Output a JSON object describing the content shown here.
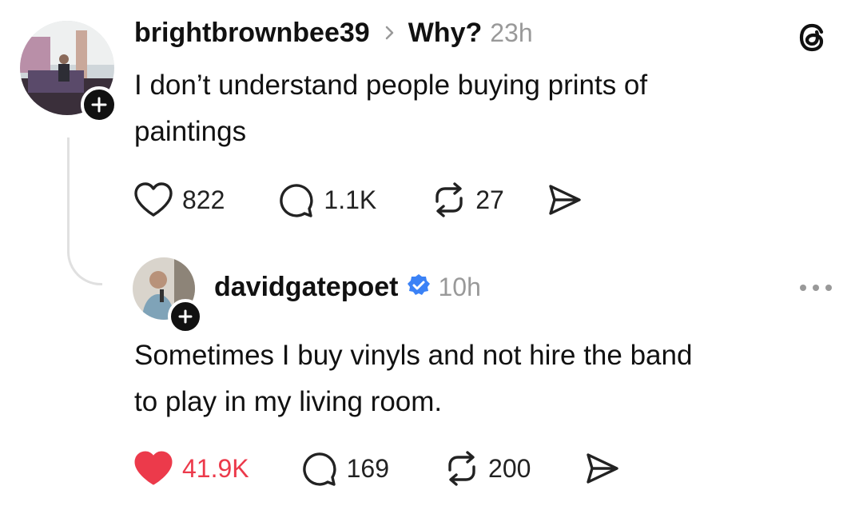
{
  "post": {
    "username": "brightbrownbee39",
    "topic": "Why?",
    "time": "23h",
    "text_line1": "I don’t understand people buying prints of",
    "text_line2": "paintings",
    "likes": "822",
    "replies": "1.1K",
    "reposts": "27"
  },
  "reply": {
    "username": "davidgatepoet",
    "time": "10h",
    "text_line1": "Sometimes I buy vinyls and not hire the band",
    "text_line2": "to play in my living room.",
    "likes": "41.9K",
    "replies": "169",
    "reposts": "200",
    "liked": true
  },
  "colors": {
    "like_active": "#ec3a4b",
    "verified": "#3b82f6",
    "muted": "#999999"
  },
  "icons": [
    "threads-logo-icon",
    "heart-icon",
    "comment-icon",
    "repost-icon",
    "share-icon",
    "verified-icon",
    "more-icon",
    "follow-plus-icon"
  ]
}
